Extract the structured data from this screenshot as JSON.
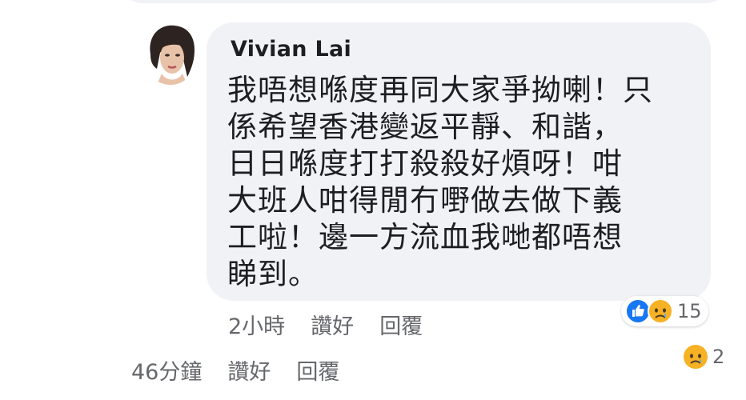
{
  "reply": {
    "author": "Vivian Lai",
    "text": "我唔想喺度再同大家爭拗喇！只\n係希望香港變返平靜、和諧，\n日日喺度打打殺殺好煩呀！咁\n大班人咁得閒冇嘢做去做下義\n工啦！邊一方流血我哋都唔想\n睇到。",
    "time": "2小時",
    "like_label": "讚好",
    "reply_label": "回覆",
    "reactions": {
      "icons": [
        "like-icon",
        "sad-face-icon"
      ],
      "count": "15",
      "colors": {
        "like": "#1877f2",
        "sad": "#f7b125"
      }
    }
  },
  "parent": {
    "time": "46分鐘",
    "like_label": "讚好",
    "reply_label": "回覆",
    "reactions": {
      "icons": [
        "sad-face-icon"
      ],
      "count": "2"
    }
  },
  "colors": {
    "bubble": "#f0f2f5",
    "text": "#1c1e21",
    "meta": "#65676b"
  }
}
